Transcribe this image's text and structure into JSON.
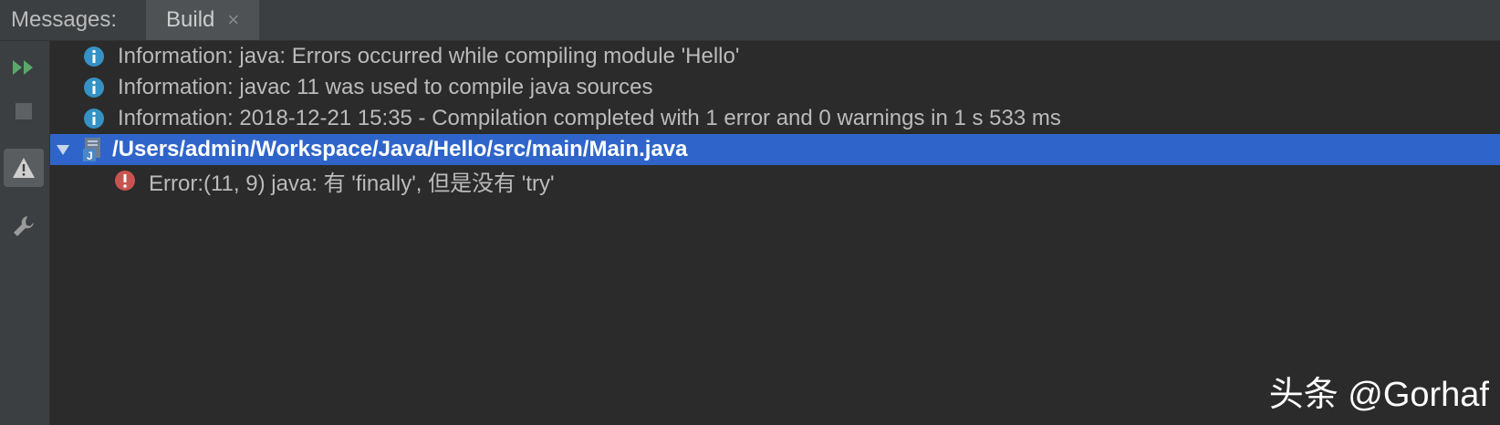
{
  "tool_window": {
    "title": "Messages:",
    "tabs": [
      {
        "label": "Build",
        "close_icon": "close-icon"
      }
    ]
  },
  "toolbar": {
    "buttons": [
      {
        "name": "rerun",
        "icon": "run-all-icon",
        "color": "#59a869"
      },
      {
        "name": "stop",
        "icon": "stop-icon"
      },
      {
        "name": "show-warnings",
        "icon": "warning-icon",
        "active": true
      },
      {
        "name": "settings",
        "icon": "wrench-icon"
      }
    ]
  },
  "messages": [
    {
      "type": "info",
      "icon": "info-icon",
      "text": "Information: java: Errors occurred while compiling module 'Hello'"
    },
    {
      "type": "info",
      "icon": "info-icon",
      "text": "Information: javac 11 was used to compile java sources"
    },
    {
      "type": "info",
      "icon": "info-icon",
      "text": "Information: 2018-12-21 15:35 - Compilation completed with 1 error and 0 warnings in 1 s 533 ms"
    }
  ],
  "file_node": {
    "expanded": true,
    "path": "/Users/admin/Workspace/Java/Hello/src/main/Main.java",
    "icon": "java-file-icon",
    "selected": true
  },
  "error": {
    "icon": "error-icon",
    "text": "Error:(11, 9)  java: 有 'finally', 但是没有 'try'"
  },
  "watermark": "头条 @Gorhaf",
  "colors": {
    "info": "#3592c4",
    "error": "#c75450",
    "selection": "#2f65ca"
  }
}
